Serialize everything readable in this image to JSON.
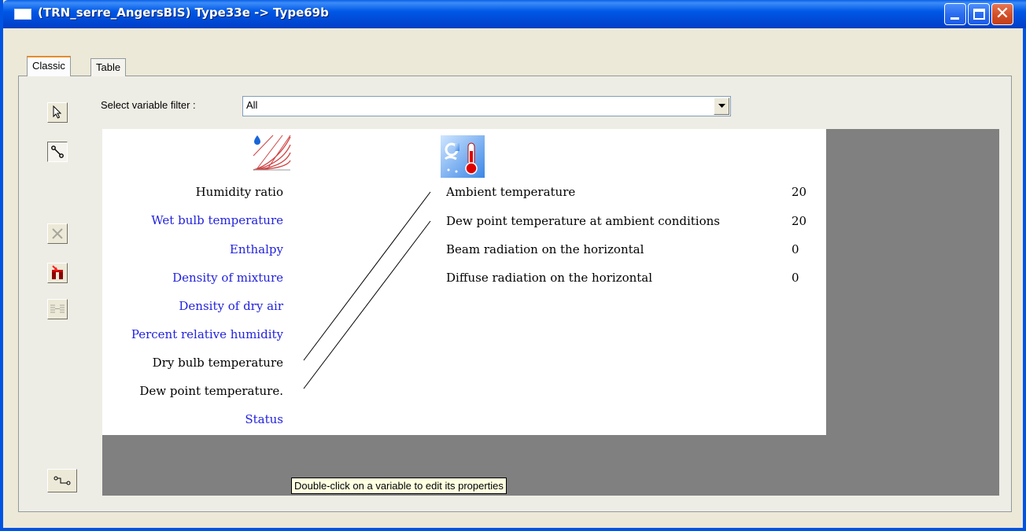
{
  "window": {
    "title": "(TRN_serre_AngersBIS) Type33e -> Type69b",
    "minimize_icon": "minimize-icon",
    "maximize_icon": "maximize-icon",
    "close_icon": "close-icon"
  },
  "tabs": [
    {
      "label": "Classic",
      "active": true
    },
    {
      "label": "Table",
      "active": false
    }
  ],
  "toolbar": {
    "tools": [
      {
        "icon": "pointer-icon",
        "state": "normal"
      },
      {
        "icon": "connect-icon",
        "state": "pressed"
      },
      {
        "icon": "delete-link-icon",
        "state": "disabled"
      },
      {
        "icon": "delete-all-links-icon",
        "state": "enabled"
      },
      {
        "icon": "auto-link-icon",
        "state": "disabled"
      },
      {
        "icon": "link-order-icon",
        "state": "normal"
      }
    ]
  },
  "filter": {
    "label": "Select variable filter :",
    "value": "All"
  },
  "source_component": {
    "icon": "psychrometrics-icon",
    "outputs": [
      {
        "label": "Humidity ratio",
        "connected": true
      },
      {
        "label": "Wet bulb temperature",
        "connected": false
      },
      {
        "label": "Enthalpy",
        "connected": false
      },
      {
        "label": "Density of mixture",
        "connected": false
      },
      {
        "label": "Density of dry air",
        "connected": false
      },
      {
        "label": "Percent relative humidity",
        "connected": false
      },
      {
        "label": "Dry bulb temperature",
        "connected": true
      },
      {
        "label": "Dew point temperature.",
        "connected": true
      },
      {
        "label": "Status",
        "connected": false
      }
    ]
  },
  "target_component": {
    "icon": "weather-thermometer-icon",
    "inputs": [
      {
        "label": "Ambient temperature",
        "value": "20"
      },
      {
        "label": "Dew point temperature at ambient conditions",
        "value": "20"
      },
      {
        "label": "Beam radiation on the horizontal",
        "value": "0"
      },
      {
        "label": "Diffuse radiation on the horizontal",
        "value": "0"
      }
    ]
  },
  "tooltip": "Double-click on a variable to edit its properties",
  "colors": {
    "titlebar": "#0054e3",
    "connected_text": "#000000",
    "unconnected_text": "#2222dd",
    "canvas_bg": "#ffffff",
    "workspace_bg": "#808080",
    "tooltip_bg": "#ffffe1"
  }
}
